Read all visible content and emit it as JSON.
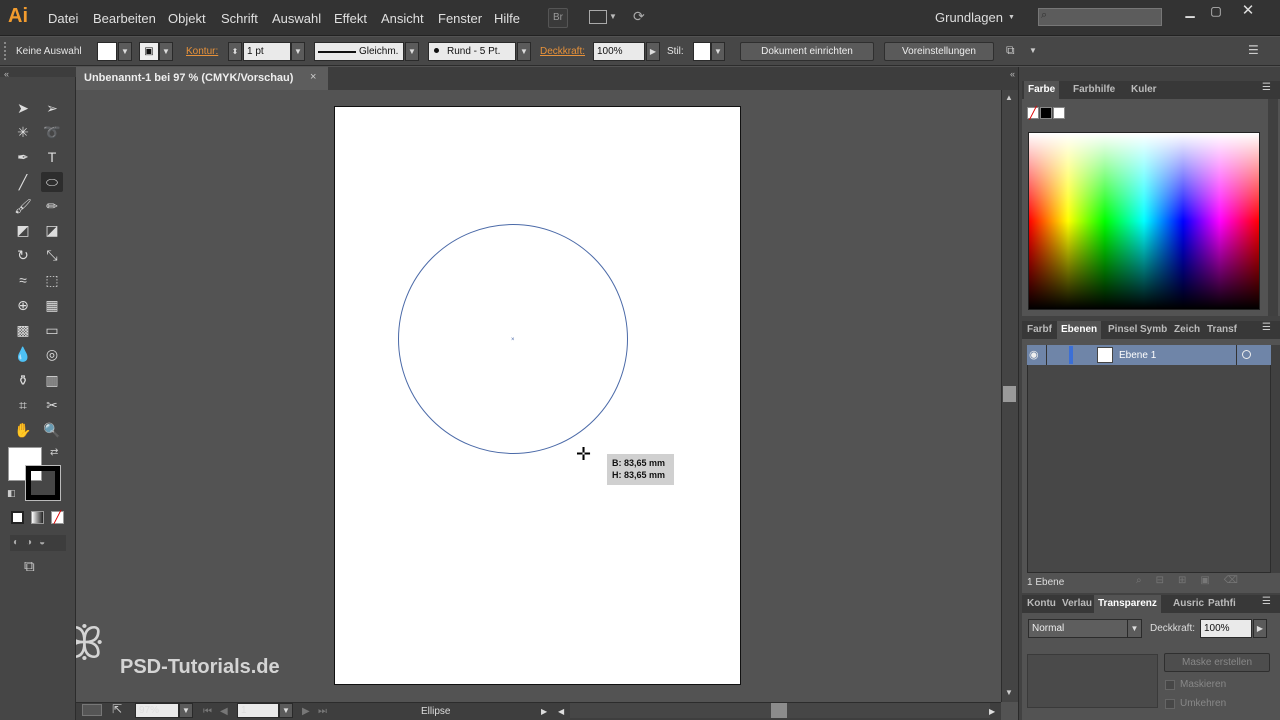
{
  "app": {
    "logo": "Ai"
  },
  "menu": [
    "Datei",
    "Bearbeiten",
    "Objekt",
    "Schrift",
    "Auswahl",
    "Effekt",
    "Ansicht",
    "Fenster",
    "Hilfe"
  ],
  "bridge_label": "Br",
  "workspace": "Grundlagen",
  "control": {
    "selection": "Keine Auswahl",
    "stroke_label": "Kontur:",
    "stroke_weight": "1 pt",
    "stroke_style": "Gleichm.",
    "brush": "Rund - 5 Pt.",
    "opacity_label": "Deckkraft:",
    "opacity": "100%",
    "style_label": "Stil:",
    "doc_setup": "Dokument einrichten",
    "prefs": "Voreinstellungen"
  },
  "document": {
    "tab_title": "Unbenannt-1 bei 97 % (CMYK/Vorschau)",
    "close": "×"
  },
  "tooltip": {
    "width": "B: 83,65 mm",
    "height": "H: 83,65 mm"
  },
  "status": {
    "zoom": "97%",
    "artboard": "1",
    "tool": "Ellipse"
  },
  "panels": {
    "color_tabs": [
      "Farbe",
      "Farbhilfe",
      "Kuler"
    ],
    "layer_tabs": [
      "Farbf",
      "Ebenen",
      "Pinsel",
      "Symb",
      "Zeich",
      "Transf"
    ],
    "layer_name": "Ebene 1",
    "layer_count": "1 Ebene",
    "trans_tabs": [
      "Kontu",
      "Verlau",
      "Transparenz",
      "Ausric",
      "Pathfi"
    ],
    "blend_mode": "Normal",
    "opacity_label": "Deckkraft:",
    "opacity": "100%",
    "mask_button": "Maske erstellen",
    "clip_label": "Maskieren",
    "invert_label": "Umkehren"
  },
  "watermark": "PSD-Tutorials.de"
}
